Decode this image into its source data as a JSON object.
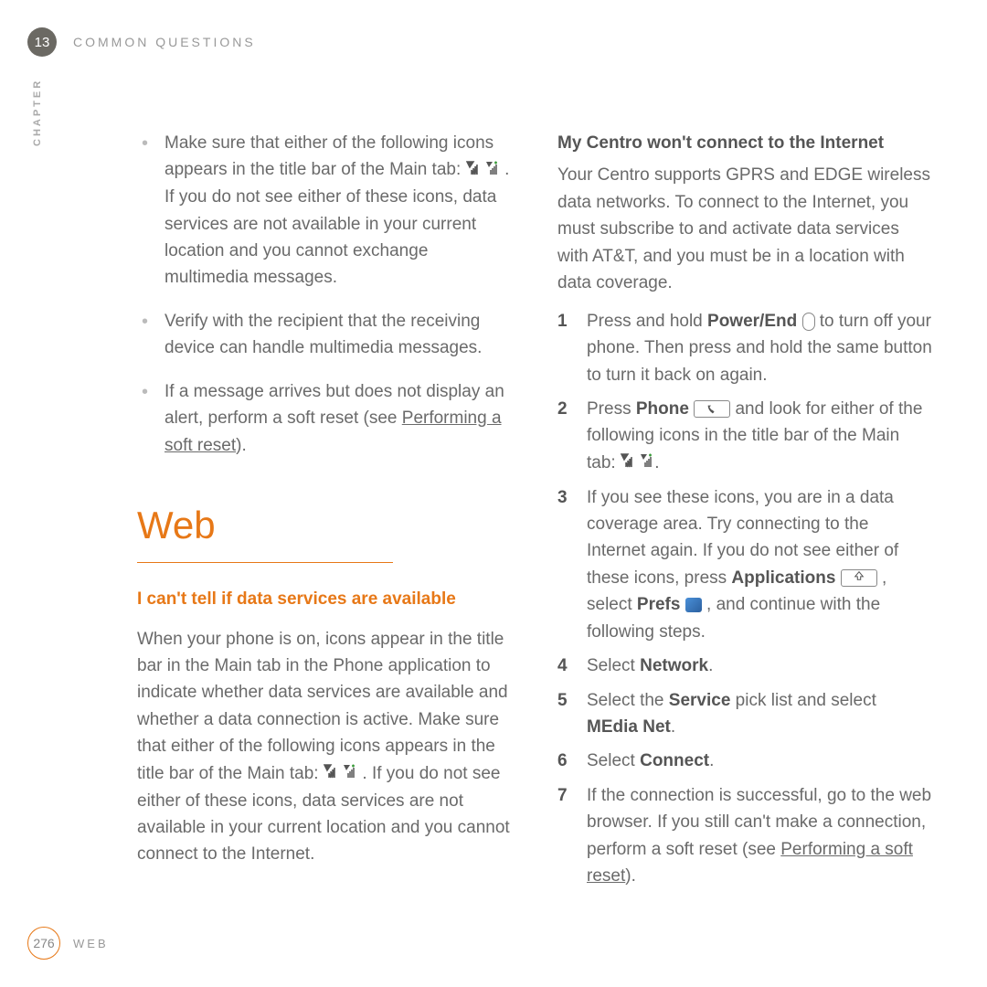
{
  "header": {
    "chapter_number": "13",
    "title": "COMMON QUESTIONS",
    "side_label": "CHAPTER"
  },
  "left_column": {
    "bullets": [
      {
        "pre": "Make sure that either of the following icons appears in the title bar of the Main tab: ",
        "post": ". If you do not see either of these icons, data services are not available in your current location and you cannot exchange multimedia messages."
      },
      {
        "text": "Verify with the recipient that the receiving device can handle multimedia messages."
      },
      {
        "pre": "If a message arrives but does not display an alert, perform a soft reset (see ",
        "link": "Performing a soft reset",
        "post": ")."
      }
    ],
    "section_title": "Web",
    "subheading": "I can't tell if data services are available",
    "paragraph_pre": "When your phone is on, icons appear in the title bar in the Main tab in the Phone application to indicate whether data services are available and whether a data connection is active. Make sure that either of the following icons appears in the title bar of the Main tab: ",
    "paragraph_post": ". If you do not see either of these icons, data services are not available in your current location and you cannot connect to the Internet."
  },
  "right_column": {
    "heading": "My Centro won't connect to the Internet",
    "intro": "Your Centro supports GPRS and EDGE wireless data networks. To connect to the Internet, you must subscribe to and activate data services with AT&T, and you must be in a location with data coverage.",
    "steps": [
      {
        "num": "1",
        "pre": "Press and hold ",
        "bold1": "Power/End",
        "post": " to turn off your phone. Then press and hold the same button to turn it back on again."
      },
      {
        "num": "2",
        "pre": "Press ",
        "bold1": "Phone",
        "mid": " and look for either of the following icons in the title bar of the Main tab: ",
        "post": "."
      },
      {
        "num": "3",
        "pre": "If you see these icons, you are in a data coverage area. Try connecting to the Internet again. If you do not see either of these icons, press ",
        "bold1": "Applications",
        "mid": " , select ",
        "bold2": "Prefs",
        "post": " , and continue with the following steps."
      },
      {
        "num": "4",
        "pre": "Select ",
        "bold1": "Network",
        "post": "."
      },
      {
        "num": "5",
        "pre": "Select the ",
        "bold1": "Service",
        "mid": " pick list and select ",
        "bold2": "MEdia Net",
        "post": "."
      },
      {
        "num": "6",
        "pre": "Select ",
        "bold1": "Connect",
        "post": "."
      },
      {
        "num": "7",
        "pre": "If the connection is successful, go to the web browser. If you still can't make a connection, perform a soft reset (see ",
        "link": "Performing a soft reset",
        "post": ")."
      }
    ]
  },
  "footer": {
    "page_number": "276",
    "label": "WEB"
  }
}
